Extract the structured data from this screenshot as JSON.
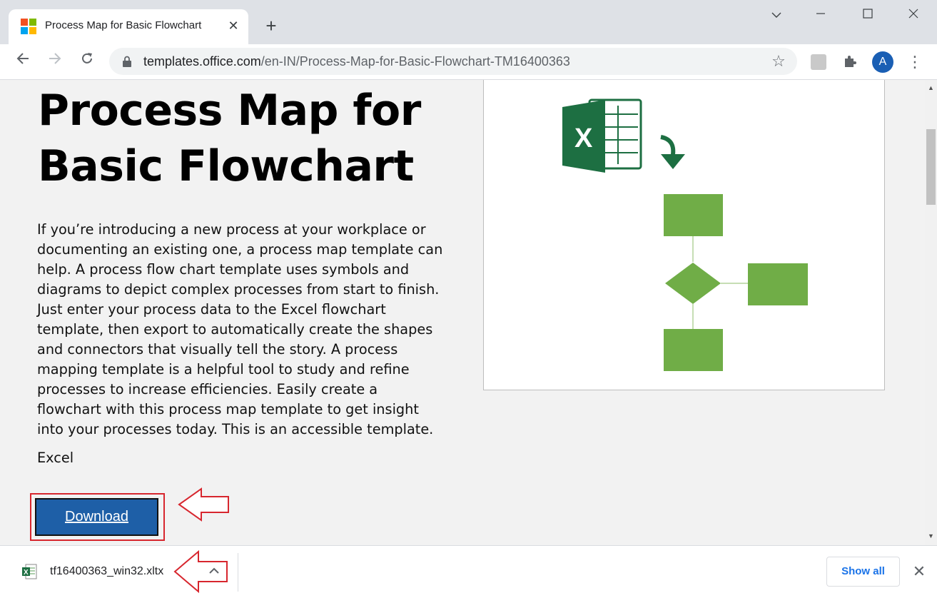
{
  "browser": {
    "tab_title": "Process Map for Basic Flowchart",
    "tab_close": "✕",
    "new_tab": "+",
    "url_host": "templates.office.com",
    "url_path": "/en-IN/Process-Map-for-Basic-Flowchart-TM16400363",
    "avatar_letter": "A",
    "window_controls": {
      "minimize": "—",
      "maximize": "☐",
      "close": "✕"
    },
    "tab_dropdown": "⌄"
  },
  "page": {
    "title": "Process Map for Basic Flowchart",
    "description": "If you’re introducing a new process at your workplace or documenting an existing one, a process map template can help. A process flow chart template uses symbols and diagrams to depict complex processes from start to finish. Just enter your process data to the Excel flowchart template, then export to automatically create the shapes and connectors that visually tell the story. A process mapping template is a helpful tool to study and refine processes to increase efficiencies. Easily create a flowchart with this process map template to get insight into your processes today. This is an accessible template.",
    "app": "Excel",
    "download_label": "Download",
    "preview_excel_letter": "X"
  },
  "download_bar": {
    "file_name": "tf16400363_win32.xltx",
    "show_all_label": "Show all"
  },
  "colors": {
    "accent_blue": "#1e5fa7",
    "highlight_red": "#d7262e",
    "excel_green": "#1d6f42",
    "shape_green": "#70ad47"
  }
}
